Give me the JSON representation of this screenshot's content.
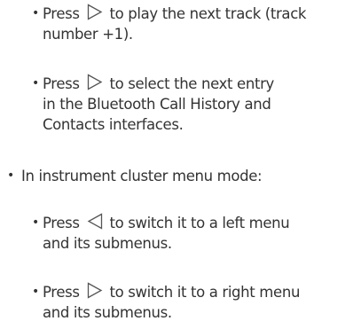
{
  "bullet_symbol": "•",
  "items": [
    {
      "level": 2,
      "press": "Press",
      "icon": "right-triangle-icon",
      "lines": [
        "to play the next track (track",
        "number +1)."
      ]
    },
    {
      "level": 2,
      "press": "Press",
      "icon": "right-triangle-icon",
      "lines": [
        "to select the next entry",
        "in the Bluetooth Call History and",
        "Contacts interfaces."
      ]
    },
    {
      "level": 1,
      "lines": [
        "In instrument cluster menu mode:"
      ]
    },
    {
      "level": 2,
      "press": "Press",
      "icon": "left-triangle-icon",
      "lines": [
        "to switch it to a left menu",
        "and its submenus."
      ]
    },
    {
      "level": 2,
      "press": "Press",
      "icon": "right-triangle-icon",
      "lines": [
        "to switch it to a right menu",
        "and its submenus."
      ]
    }
  ]
}
